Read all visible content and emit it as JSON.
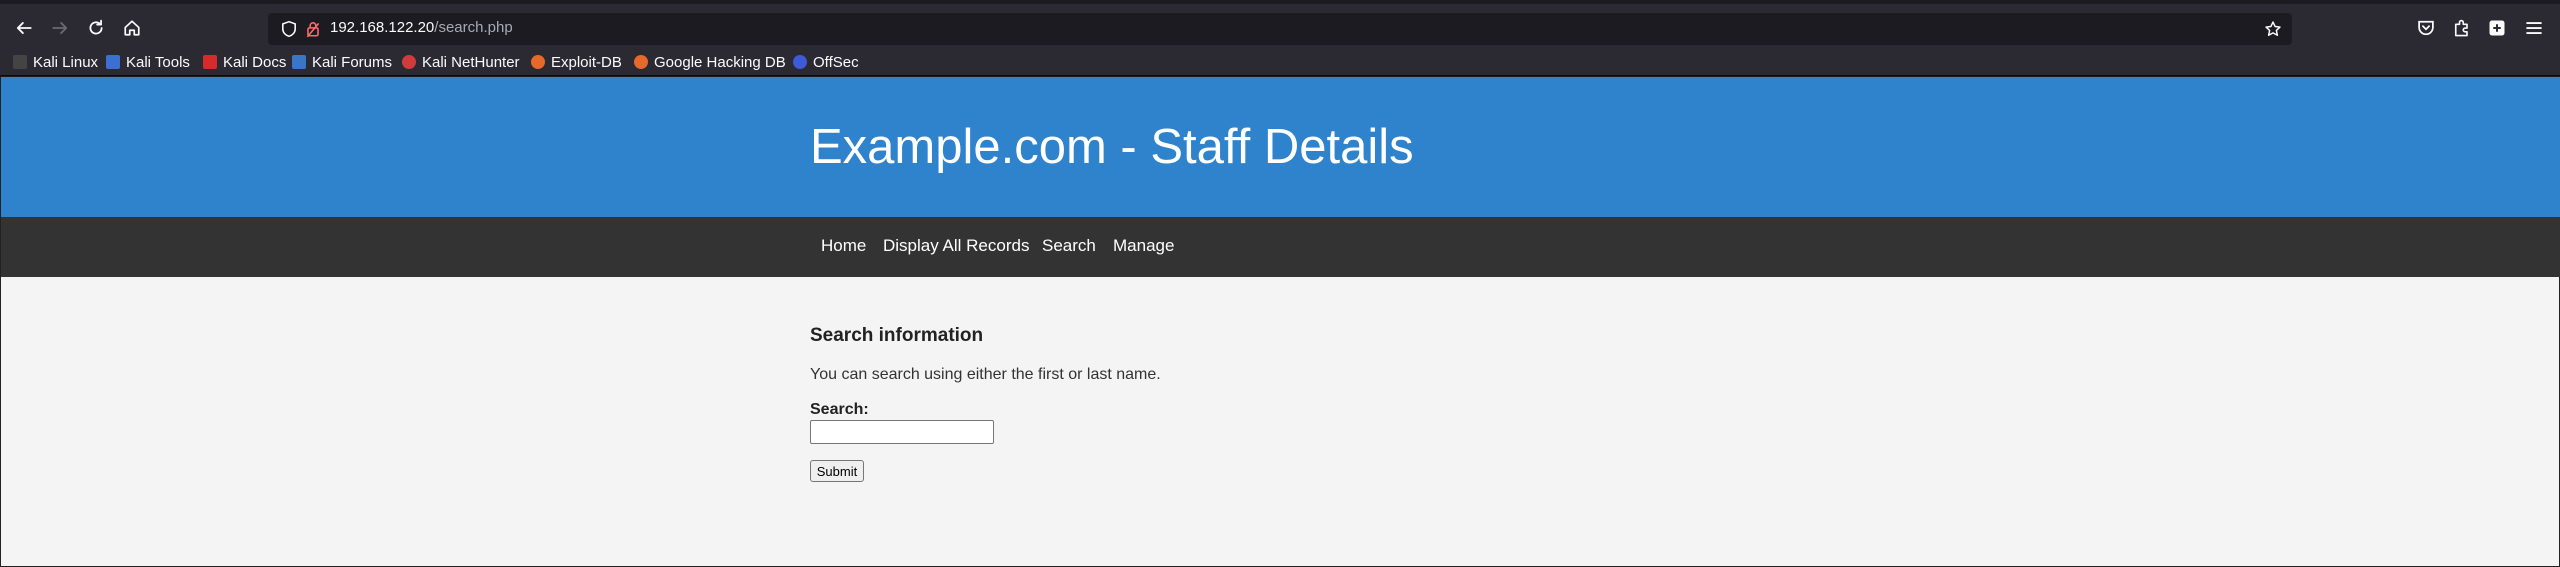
{
  "browser": {
    "url_host": "192.168.122.20",
    "url_path": "/search.php",
    "bookmarks": [
      {
        "label": "Kali Linux",
        "color": "#3a3a3a"
      },
      {
        "label": "Kali Tools",
        "color": "#3b6fd1"
      },
      {
        "label": "Kali Docs",
        "color": "#d62b2b"
      },
      {
        "label": "Kali Forums",
        "color": "#3a76c8"
      },
      {
        "label": "Kali NetHunter",
        "color": "#d23b3b"
      },
      {
        "label": "Exploit-DB",
        "color": "#e6682a"
      },
      {
        "label": "Google Hacking DB",
        "color": "#e6682a"
      },
      {
        "label": "OffSec",
        "color": "#3d5bd8"
      }
    ]
  },
  "site": {
    "title": "Example.com - Staff Details",
    "nav": [
      "Home",
      "Display All Records",
      "Search",
      "Manage"
    ],
    "section_heading": "Search information",
    "instructions": "You can search using either the first or last name.",
    "search_label": "Search:",
    "search_value": "",
    "submit_label": "Submit"
  },
  "colors": {
    "banner": "#2e83cc",
    "navbar": "#333333",
    "page_bg": "#f4f4f4"
  }
}
